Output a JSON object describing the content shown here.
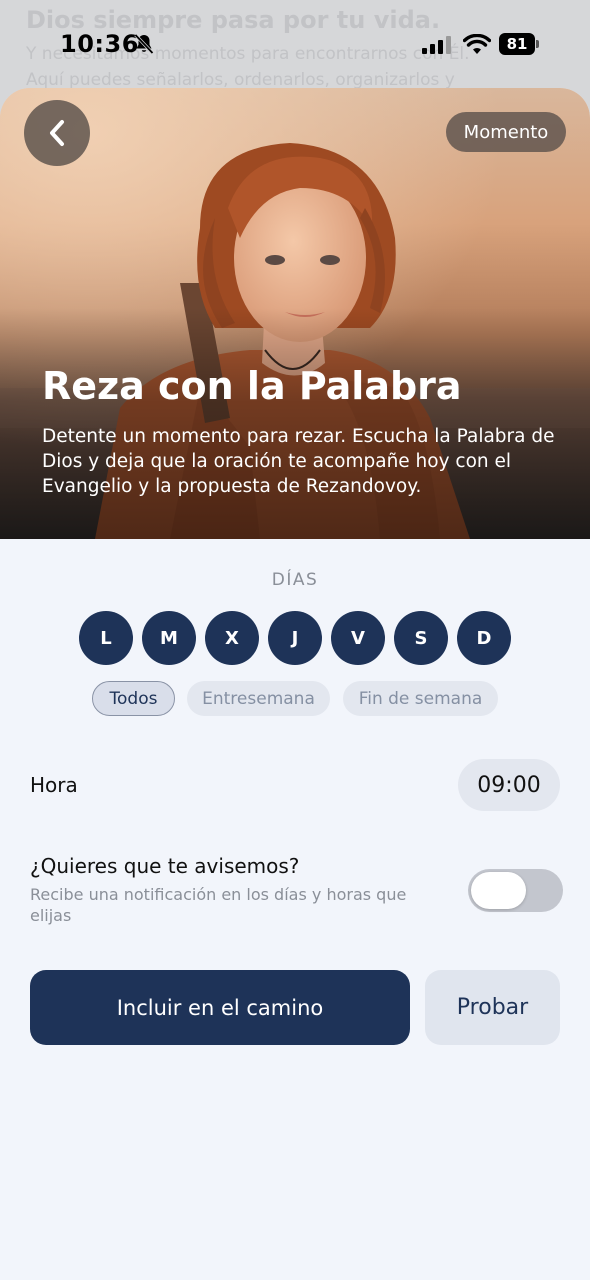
{
  "background_page": {
    "title": "Dios siempre pasa por tu vida.",
    "line1": "Y necesitamos momentos para encontrarnos con Él.",
    "line2": "Aquí puedes señalarlos, ordenarlos, organizarlos y"
  },
  "status_bar": {
    "time": "10:36",
    "battery": "81"
  },
  "hero": {
    "badge": "Momento",
    "title": "Reza con la Palabra",
    "description": "Detente un momento para rezar. Escucha la Palabra de Dios y deja que la oración te acompañe hoy con el Evangelio y la propuesta de Rezandovoy."
  },
  "days_section": {
    "label": "DÍAS",
    "days": [
      "L",
      "M",
      "X",
      "J",
      "V",
      "S",
      "D"
    ],
    "chips": [
      "Todos",
      "Entresemana",
      "Fin de semana"
    ],
    "selected_chip": "Todos"
  },
  "time_row": {
    "label": "Hora",
    "value": "09:00"
  },
  "notification": {
    "title": "¿Quieres que te avisemos?",
    "subtitle": "Recibe una notificación en los días y horas que elijas",
    "enabled": false
  },
  "actions": {
    "primary": "Incluir en el camino",
    "secondary": "Probar"
  },
  "colors": {
    "accent": "#1e3358",
    "background": "#f2f5fb"
  }
}
